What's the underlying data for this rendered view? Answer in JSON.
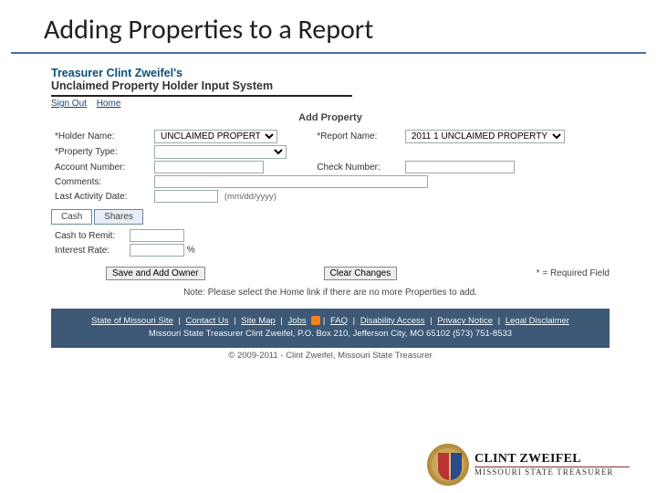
{
  "slide": {
    "title": "Adding Properties to a Report"
  },
  "header": {
    "line1": "Treasurer Clint Zweifel's",
    "line2": "Unclaimed Property Holder Input System"
  },
  "nav": {
    "signout": "Sign Out",
    "home": "Home"
  },
  "page": {
    "subtitle": "Add Property"
  },
  "form": {
    "holder_label": "*Holder Name:",
    "holder_value": "UNCLAIMED PROPERTY",
    "report_label": "*Report Name:",
    "report_value": "2011 1 UNCLAIMED PROPERTY",
    "ptype_label": "*Property Type:",
    "account_label": "Account Number:",
    "check_label": "Check Number:",
    "comments_label": "Comments:",
    "lastactivity_label": "Last Activity Date:",
    "date_hint": "(mm/dd/yyyy)"
  },
  "tabs": {
    "cash": "Cash",
    "shares": "Shares"
  },
  "cash": {
    "remit_label": "Cash to Remit:",
    "rate_label": "Interest Rate:",
    "pct": "%"
  },
  "buttons": {
    "save": "Save and Add Owner",
    "clear": "Clear Changes"
  },
  "req_note": "* = Required Field",
  "note": "Note: Please select the Home link if there are no more Properties to add.",
  "footer": {
    "links": [
      "State of Missouri Site",
      "Contact Us",
      "Site Map",
      "Jobs",
      "FAQ",
      "Disability Access",
      "Privacy Notice",
      "Legal Disclaimer"
    ],
    "address": "Missouri State Treasurer Clint Zweifel, P.O. Box 210, Jefferson City, MO 65102  (573) 751-8533",
    "copyright": "© 2009-2011 - Clint Zweifel, Missouri State Treasurer"
  },
  "logo": {
    "name": "CLINT ZWEIFEL",
    "sub": "MISSOURI STATE TREASURER"
  }
}
